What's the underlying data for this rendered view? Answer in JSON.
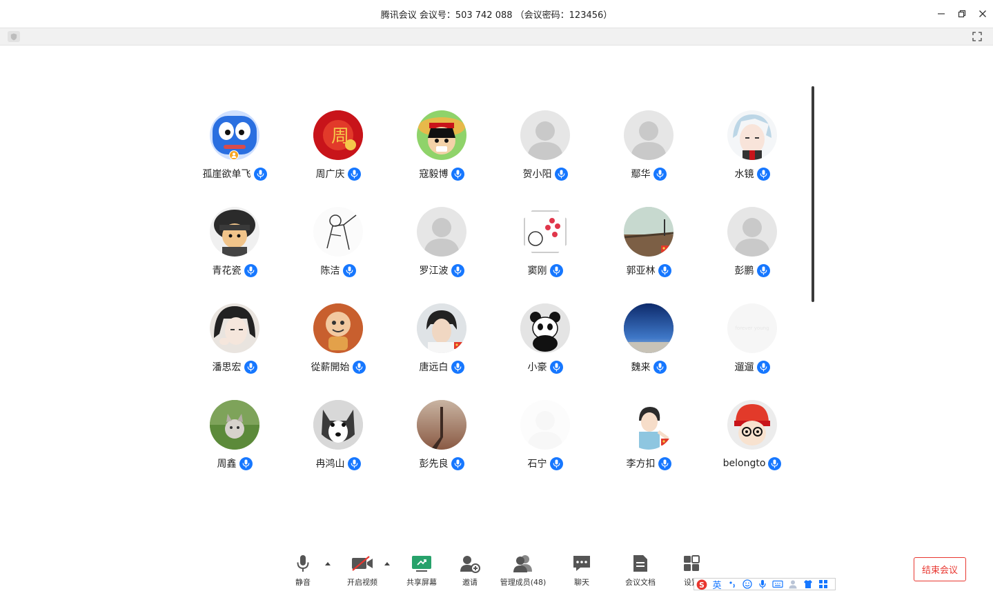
{
  "window": {
    "title": "腾讯会议 会议号：503 742 088 （会议密码：123456）"
  },
  "colors": {
    "accent": "#1677ff",
    "danger": "#e8362f",
    "share_green": "#27a26b",
    "video_off_red": "#e8362f"
  },
  "participants": [
    {
      "name": "孤崖欲单飞",
      "avatar": "blue-monster",
      "host": true
    },
    {
      "name": "周广庆",
      "avatar": "red-zhou"
    },
    {
      "name": "寇毅博",
      "avatar": "luffy"
    },
    {
      "name": "贺小阳",
      "avatar": "default"
    },
    {
      "name": "鄢华",
      "avatar": "default"
    },
    {
      "name": "水镜",
      "avatar": "anime-silver"
    },
    {
      "name": "青花瓷",
      "avatar": "soldier"
    },
    {
      "name": "陈洁",
      "avatar": "sketch"
    },
    {
      "name": "罗江波",
      "avatar": "default"
    },
    {
      "name": "窦刚",
      "avatar": "hearts"
    },
    {
      "name": "郭亚林",
      "avatar": "pier",
      "flag": true
    },
    {
      "name": "彭鹏",
      "avatar": "default"
    },
    {
      "name": "潘思宏",
      "avatar": "anime-dark"
    },
    {
      "name": "從薪開始",
      "avatar": "monkey"
    },
    {
      "name": "唐远白",
      "avatar": "boy-photo",
      "flag": true
    },
    {
      "name": "小豪",
      "avatar": "panda"
    },
    {
      "name": "魏来",
      "avatar": "sky"
    },
    {
      "name": "遛遛",
      "avatar": "faded"
    },
    {
      "name": "周鑫",
      "avatar": "kitten"
    },
    {
      "name": "冉鸿山",
      "avatar": "husky"
    },
    {
      "name": "彭先良",
      "avatar": "shadow"
    },
    {
      "name": "石宁",
      "avatar": "white-faded"
    },
    {
      "name": "李方扣",
      "avatar": "boy-drawing",
      "flag": true
    },
    {
      "name": "belongto",
      "avatar": "red-hat"
    }
  ],
  "toolbar": {
    "mute": "静音",
    "video": "开启视频",
    "share": "共享屏幕",
    "invite": "邀请",
    "members": "管理成员(48)",
    "chat": "聊天",
    "docs": "会议文档",
    "settings": "设置",
    "end": "结束会议"
  },
  "ime": {
    "lang": "英"
  }
}
